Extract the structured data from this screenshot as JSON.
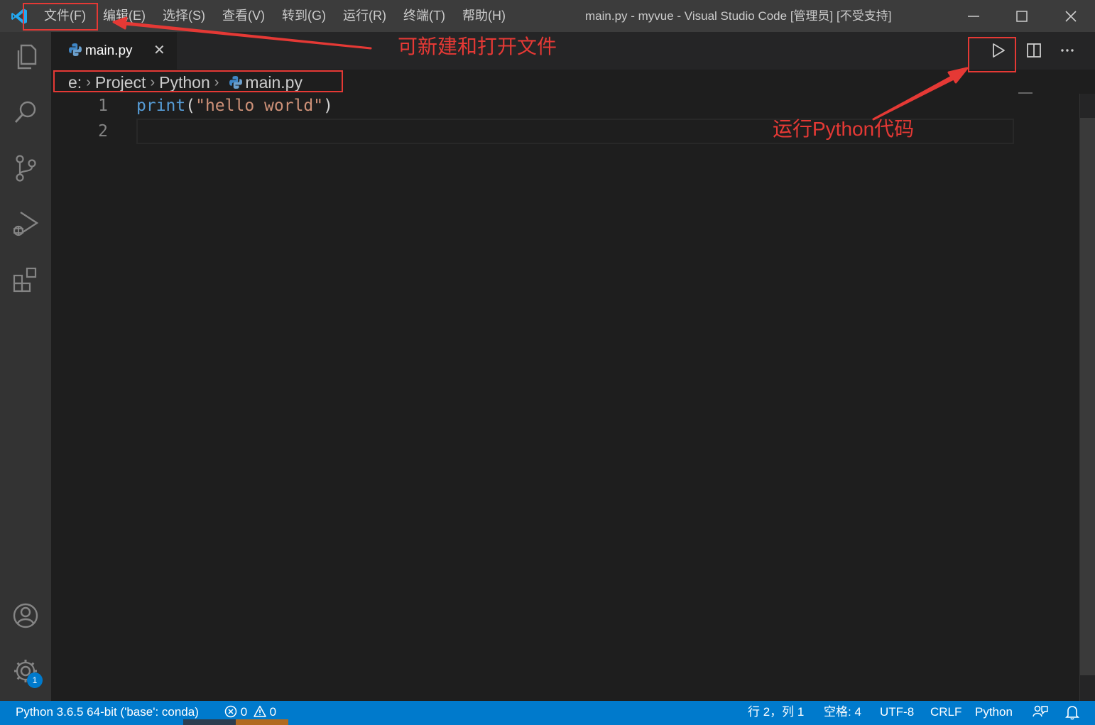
{
  "titlebar": {
    "menu": [
      "文件(F)",
      "编辑(E)",
      "选择(S)",
      "查看(V)",
      "转到(G)",
      "运行(R)",
      "终端(T)",
      "帮助(H)"
    ],
    "title": "main.py - myvue - Visual Studio Code [管理员] [不受支持]",
    "minimize": "—",
    "maximize": "☐",
    "close": "✕"
  },
  "activitybar": {
    "icons": [
      "explorer-icon",
      "search-icon",
      "source-control-icon",
      "run-debug-icon",
      "extensions-icon",
      "account-icon",
      "settings-gear-icon"
    ],
    "settings_badge": "1"
  },
  "tabs": [
    {
      "label": "main.py",
      "close": "✕",
      "icon": "python-icon"
    }
  ],
  "editor_actions": [
    "run-python-file-icon",
    "split-editor-icon",
    "more-actions-icon"
  ],
  "breadcrumb": [
    "e:",
    "Project",
    "Python",
    "main.py"
  ],
  "editor": {
    "lines": [
      {
        "number": "1",
        "tokens": [
          {
            "t": "print",
            "k": "fn"
          },
          {
            "t": "(",
            "k": "punc"
          },
          {
            "t": "\"hello world\"",
            "k": "str"
          },
          {
            "t": ")",
            "k": "punc"
          }
        ]
      },
      {
        "number": "2",
        "tokens": []
      }
    ]
  },
  "statusbar": {
    "interpreter": "Python 3.6.5 64-bit ('base': conda)",
    "errors": "0",
    "warnings": "0",
    "cursor": "行 2，列 1",
    "indent": "空格: 4",
    "encoding": "UTF-8",
    "eol": "CRLF",
    "language": "Python"
  },
  "annotations": {
    "file_menu_note": "可新建和打开文件",
    "run_note": "运行Python代码"
  },
  "colors": {
    "accent": "#007acc",
    "annotation": "#e53935"
  }
}
